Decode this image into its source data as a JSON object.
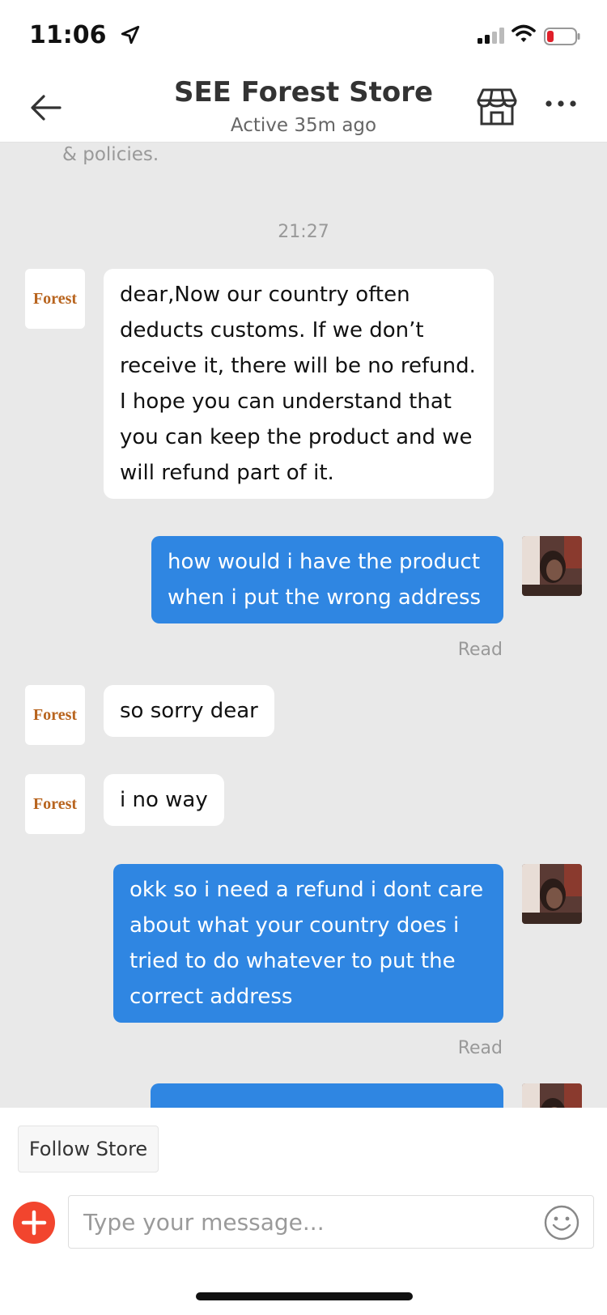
{
  "status_bar": {
    "time": "11:06",
    "location_icon": "location-arrow-icon",
    "signal_icon": "cell-signal-icon",
    "wifi_icon": "wifi-icon",
    "battery_icon": "battery-low-icon",
    "battery_color": "#e0202a"
  },
  "header": {
    "title": "SEE Forest Store",
    "subtitle": "Active 35m ago",
    "back_icon": "arrow-left-icon",
    "store_icon": "storefront-icon",
    "more_icon": "more-dots-icon"
  },
  "chat": {
    "policies_text": "& policies.",
    "timestamp": "21:27",
    "store_avatar_label": "Forest",
    "messages": [
      {
        "from": "store",
        "text": "dear,Now our country often deducts customs. If we don’t receive it, there will be no refund. I hope you can understand that you can keep the product and we will refund part of it."
      },
      {
        "from": "user",
        "text": "how would i have the product when i put the wrong address",
        "status": "Read"
      },
      {
        "from": "store",
        "text": "so sorry dear"
      },
      {
        "from": "store",
        "text": "i no way"
      },
      {
        "from": "user",
        "text": "okk so i need a refund i dont care about what your country does i tried to do whatever to put the correct address",
        "status": "Read"
      },
      {
        "from": "user",
        "text": "",
        "status": ""
      }
    ]
  },
  "footer": {
    "follow_label": "Follow Store",
    "add_icon": "add-circle-icon",
    "input_placeholder": "Type your message...",
    "input_value": "",
    "emoji_icon": "smiley-icon"
  },
  "colors": {
    "accent_blue": "#2f86e2",
    "add_red": "#f2452e",
    "chat_bg": "#e9e9e9"
  }
}
